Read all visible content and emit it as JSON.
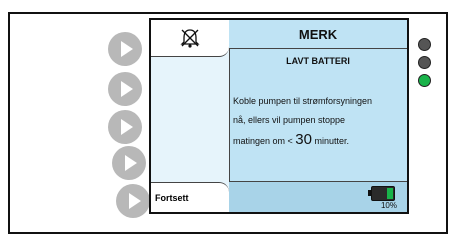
{
  "screen": {
    "title": "MERK",
    "subtitle": "LAVT BATTERI",
    "message_line1": "Koble pumpen til strømforsyningen",
    "message_line2": "nå, ellers vil pumpen stoppe",
    "message_line3_prefix": "matingen om < ",
    "message_minutes": "30",
    "message_line3_suffix": " minutter.",
    "softkey_label": "Fortsett",
    "battery_percent": "10%",
    "battery_level": 0.1,
    "bell_icon": "bell-muted-icon"
  },
  "indicators": [
    {
      "name": "led-1",
      "color": "#555555"
    },
    {
      "name": "led-2",
      "color": "#555555"
    },
    {
      "name": "led-3",
      "color": "#19b34a"
    }
  ]
}
